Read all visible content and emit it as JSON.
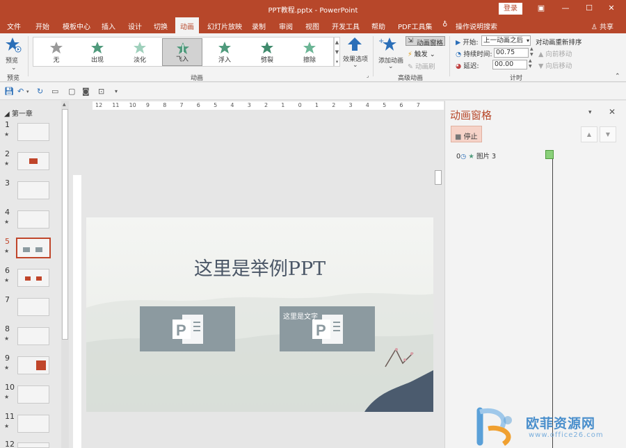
{
  "window": {
    "title": "PPT教程.pptx  -  PowerPoint",
    "login": "登录"
  },
  "tabs": [
    "文件",
    "开始",
    "模板中心",
    "插入",
    "设计",
    "切换",
    "动画",
    "幻灯片放映",
    "录制",
    "审阅",
    "视图",
    "开发工具",
    "帮助",
    "PDF工具集",
    "操作说明搜索"
  ],
  "share": "共享",
  "ribbon": {
    "preview_label": "预览",
    "preview_group": "预览",
    "gallery": [
      "无",
      "出现",
      "淡化",
      "飞入",
      "浮入",
      "劈裂",
      "擦除"
    ],
    "effect_options": "效果选项",
    "animation_group": "动画",
    "add_animation": "添加动画",
    "anim_pane": "动画窗格",
    "trigger": "触发",
    "anim_brush": "动画刷",
    "advanced_group": "高级动画",
    "start_label": "开始:",
    "start_value": "上一动画之后",
    "duration_label": "持续时间:",
    "duration_value": "00.75",
    "delay_label": "延迟:",
    "delay_value": "00.00",
    "reorder": "对动画重新排序",
    "move_earlier": "向前移动",
    "move_later": "向后移动",
    "timing_group": "计时"
  },
  "outline": {
    "section": "第一章",
    "slides": [
      "1",
      "2",
      "3",
      "4",
      "5",
      "6",
      "7",
      "8",
      "9",
      "10",
      "11",
      "12"
    ]
  },
  "ruler": {
    "h_ticks": [
      "12",
      "11",
      "10",
      "9",
      "8",
      "7",
      "6",
      "5",
      "4",
      "3",
      "2",
      "1",
      "0",
      "1",
      "2",
      "3",
      "4",
      "5",
      "6",
      "7"
    ]
  },
  "slide": {
    "title": "这里是举例PPT",
    "box2_caption": "这里是文字"
  },
  "anim_pane": {
    "title": "动画窗格",
    "stop": "停止",
    "item_index": "0",
    "item_name": "图片 3"
  },
  "watermark": {
    "brand": "欧菲资源网",
    "url": "www.office26.com"
  },
  "colors": {
    "accent": "#b7472a",
    "star": "#5a9e8a"
  }
}
